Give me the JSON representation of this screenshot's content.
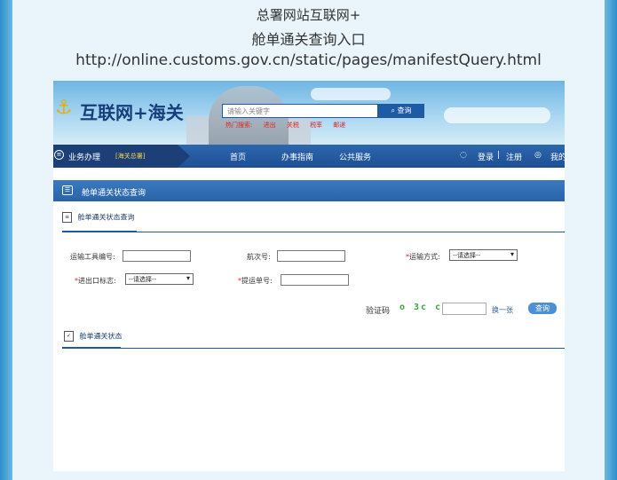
{
  "caption": {
    "line1": "总署网站互联网+",
    "line2": "舱单通关查询入口",
    "url": "http://online.customs.gov.cn/static/pages/manifestQuery.html"
  },
  "header": {
    "logo_text": "互联网+海关",
    "search_placeholder": "请输入关键字",
    "search_button": "查询",
    "hot_label": "热门搜索:",
    "hot_items": [
      "进出",
      "关税",
      "税率",
      "邮递"
    ]
  },
  "nav": {
    "business": "业务办理",
    "hq": "[海关总署]",
    "home": "首页",
    "guide": "办事指南",
    "public": "公共服务",
    "login": "登录",
    "register": "注册",
    "mine": "我的"
  },
  "section": {
    "title": "舱单通关状态查询"
  },
  "form": {
    "tab_label": "舱单通关状态查询",
    "vehicle_no_label": "运输工具编号:",
    "voyage_label": "航次号:",
    "transport_mode_label": "运输方式:",
    "transport_mode_value": "--请选择--",
    "ie_flag_label": "进出口标志:",
    "ie_flag_value": "--请选择--",
    "bill_no_label": "提运单号:",
    "captcha_label": "验证码",
    "captcha_text": "o 3c c",
    "refresh_label": "换一张",
    "query_button": "查询"
  },
  "results": {
    "tab_label": "舱单通关状态"
  },
  "colors": {
    "brand_blue": "#1f5aa5",
    "required_red": "#d22222",
    "captcha_green": "#3aa33a"
  }
}
